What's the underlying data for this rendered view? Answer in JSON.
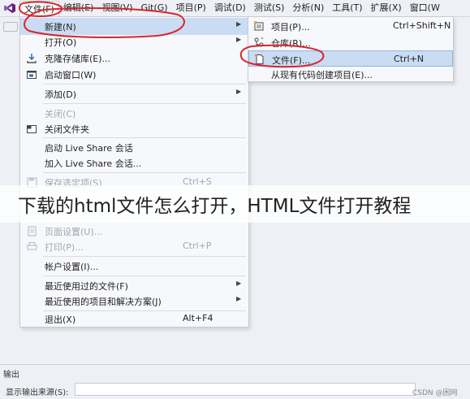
{
  "menubar": {
    "items": [
      {
        "label": "文件(F)"
      },
      {
        "label": "编辑(E)"
      },
      {
        "label": "视图(V)"
      },
      {
        "label": "Git(G)"
      },
      {
        "label": "项目(P)"
      },
      {
        "label": "调试(D)"
      },
      {
        "label": "测试(S)"
      },
      {
        "label": "分析(N)"
      },
      {
        "label": "工具(T)"
      },
      {
        "label": "扩展(X)"
      },
      {
        "label": "窗口(W"
      }
    ]
  },
  "file_menu": {
    "items": [
      {
        "label": "新建(N)",
        "has_submenu": true
      },
      {
        "label": "打开(O)",
        "has_submenu": true
      },
      {
        "label": "克隆存储库(E)..."
      },
      {
        "label": "启动窗口(W)"
      },
      {
        "label": "添加(D)",
        "has_submenu": true
      },
      {
        "label": "关闭(C)"
      },
      {
        "label": "关闭文件夹"
      },
      {
        "label": "启动 Live Share 会话"
      },
      {
        "label": "加入 Live Share 会话..."
      },
      {
        "label": "保存选定项(S)",
        "shortcut": "Ctrl+S"
      },
      {
        "label": "页面设置(U)..."
      },
      {
        "label": "打印(P)...",
        "shortcut": "Ctrl+P"
      },
      {
        "label": "帐户设置(I)..."
      },
      {
        "label": "最近使用过的文件(F)",
        "has_submenu": true
      },
      {
        "label": "最近使用的项目和解决方案(J)",
        "has_submenu": true
      },
      {
        "label": "退出(X)",
        "shortcut": "Alt+F4"
      }
    ]
  },
  "new_submenu": {
    "items": [
      {
        "label": "项目(P)...",
        "shortcut": "Ctrl+Shift+N"
      },
      {
        "label": "仓库(R)..."
      },
      {
        "label": "文件(F)...",
        "shortcut": "Ctrl+N"
      },
      {
        "label": "从现有代码创建项目(E)..."
      }
    ]
  },
  "watermark": {
    "text": "下载的html文件怎么打开，HTML文件打开教程"
  },
  "output_panel": {
    "title": "输出",
    "source_label": "显示输出来源(S):"
  },
  "credit": "CSDN @困网",
  "colors": {
    "highlight": "#c9dcf3",
    "annotation": "#d8262c",
    "vs_logo": "#68217a"
  }
}
